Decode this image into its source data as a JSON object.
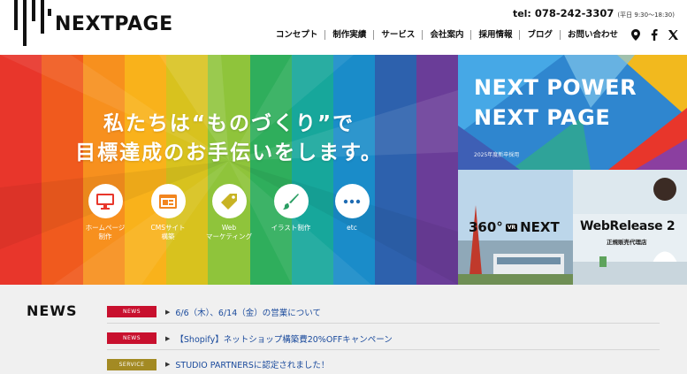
{
  "brand": {
    "name": "NEXTPAGE"
  },
  "contact": {
    "tel_label": "tel:",
    "tel_number": "078-242-3307",
    "hours": "(平日 9:30〜18:30)"
  },
  "nav": {
    "items": [
      {
        "label": "コンセプト"
      },
      {
        "label": "制作実績"
      },
      {
        "label": "サービス"
      },
      {
        "label": "会社案内"
      },
      {
        "label": "採用情報"
      },
      {
        "label": "ブログ"
      },
      {
        "label": "お問い合わせ"
      }
    ],
    "icons": [
      "map-pin-icon",
      "facebook-icon",
      "x-icon"
    ]
  },
  "hero": {
    "line1": "私たちは“ものづくり”で",
    "line2": "目標達成のお手伝いをします。",
    "band_colors": [
      "#e8362b",
      "#f05a1e",
      "#f7901e",
      "#f9b21b",
      "#d8c21e",
      "#8fc43b",
      "#2fae5c",
      "#17a79b",
      "#1a8cc9",
      "#2d61ad",
      "#6a3d98"
    ],
    "services": [
      {
        "icon": "monitor-icon",
        "label": "ホームページ\n制作",
        "color": "#e8362b"
      },
      {
        "icon": "cms-window-icon",
        "label": "CMSサイト\n構築",
        "color": "#f2851f"
      },
      {
        "icon": "price-tag-icon",
        "label": "Web\nマーケティング",
        "color": "#c8b324"
      },
      {
        "icon": "brush-icon",
        "label": "イラスト制作",
        "color": "#2a9e63"
      },
      {
        "icon": "more-dots-icon",
        "label": "etc",
        "color": "#1f6cb3"
      }
    ]
  },
  "banners": {
    "power": {
      "line1": "NEXT POWER",
      "line2": "NEXT PAGE",
      "sub": "2025年度新卒採用"
    },
    "vr": {
      "prefix": "360°",
      "badge": "VR",
      "suffix": "NEXT"
    },
    "webrelease": {
      "title": "WebRelease 2",
      "sub": "正規販売代理店"
    }
  },
  "news": {
    "title": "NEWS",
    "items": [
      {
        "tag": "NEWS",
        "tag_color": "#c8102e",
        "text": "6/6（木）、6/14（金）の営業について"
      },
      {
        "tag": "NEWS",
        "tag_color": "#c8102e",
        "text": "【Shopify】ネットショップ構築費20%OFFキャンペーン"
      },
      {
        "tag": "SERVICE",
        "tag_color": "#a38a23",
        "text": "STUDIO PARTNERSに認定されました！"
      }
    ]
  }
}
